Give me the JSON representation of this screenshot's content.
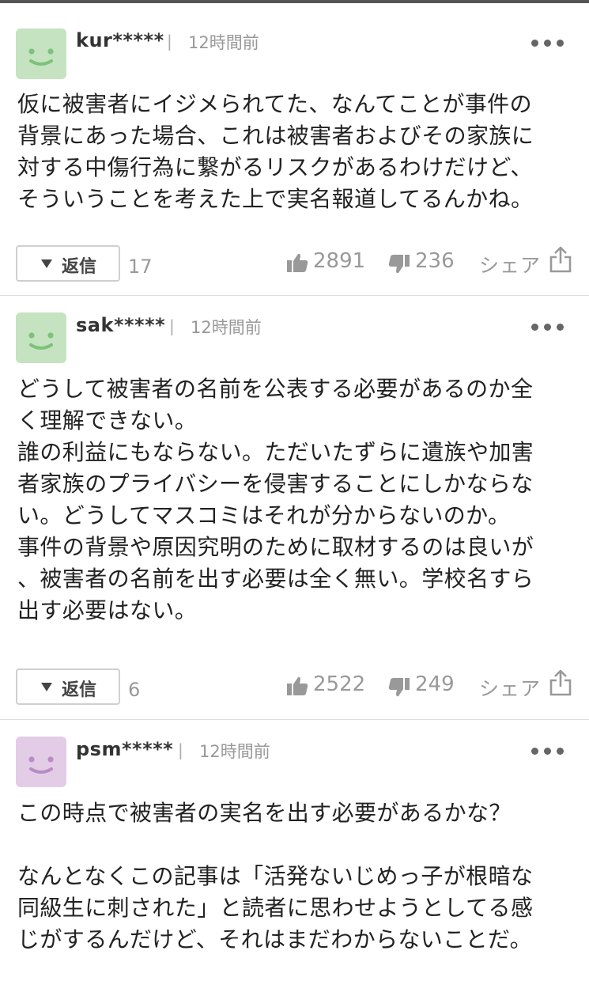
{
  "comments": [
    {
      "user": "kur*****",
      "separator": "|",
      "time": "12時間前",
      "avatar_color": "#c5e3c0",
      "face_color": "#7cc27a",
      "body": "仮に被害者にイジメられてた、なんてことが事件の\n背景にあった場合、これは被害者およびその家族に\n対する中傷行為に繋がるリスクがあるわけだけど、\nそういうことを考えた上で実名報道してるんかね。",
      "reply_label": "返信",
      "reply_count": "17",
      "likes": "2891",
      "dislikes": "236",
      "share_label": "シェア"
    },
    {
      "user": "sak*****",
      "separator": "|",
      "time": "12時間前",
      "avatar_color": "#c5e3c0",
      "face_color": "#7cc27a",
      "body": "どうして被害者の名前を公表する必要があるのか全\nく理解できない。\n誰の利益にもならない。ただいたずらに遺族や加害\n者家族のプライバシーを侵害することにしかならな\nい。どうしてマスコミはそれが分からないのか。\n事件の背景や原因究明のために取材するのは良いが\n、被害者の名前を出す必要は全く無い。学校名すら\n出す必要はない。",
      "reply_label": "返信",
      "reply_count": "6",
      "likes": "2522",
      "dislikes": "249",
      "share_label": "シェア"
    },
    {
      "user": "psm*****",
      "separator": "|",
      "time": "12時間前",
      "avatar_color": "#e3cce6",
      "face_color": "#b88cc4",
      "body": "この時点で被害者の実名を出す必要があるかな？\n\nなんとなくこの記事は「活発ないじめっ子が根暗な\n同級生に刺された」と読者に思わせようとしてる感\nじがするんだけど、それはまだわからないことだ。"
    }
  ],
  "icons": {
    "more": "more-dots-icon",
    "like": "thumbs-up-icon",
    "dislike": "thumbs-down-icon",
    "share": "share-icon",
    "reply": "triangle-down-icon"
  }
}
